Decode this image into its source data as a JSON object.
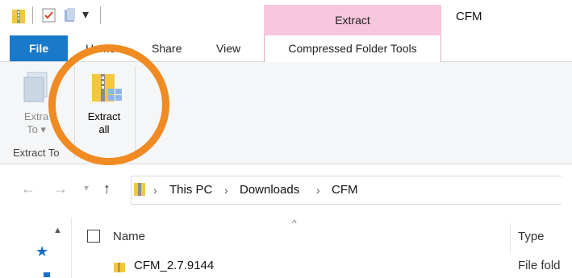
{
  "titlebar": {
    "context_tab": "Extract",
    "window_title": "CFM"
  },
  "ribbon_tabs": {
    "file": "File",
    "home": "Home",
    "share": "Share",
    "view": "View",
    "compressed": "Compressed Folder Tools"
  },
  "ribbon": {
    "extract_to": "Extract To",
    "extract_to_line1": "Extra",
    "extract_to_line2": "To",
    "extract_all_line1": "Extract",
    "extract_all_line2": "all",
    "group_label": "Extract To"
  },
  "address": {
    "crumbs": [
      "This PC",
      "Downloads",
      "CFM"
    ]
  },
  "filelist": {
    "columns": [
      "Name",
      "Type"
    ],
    "rows": [
      {
        "name": "CFM_2.7.9144",
        "type": "File fold"
      }
    ]
  },
  "colors": {
    "accent": "#1979ca",
    "context_tab": "#f7c5dc",
    "highlight_ring": "#f08a22"
  }
}
